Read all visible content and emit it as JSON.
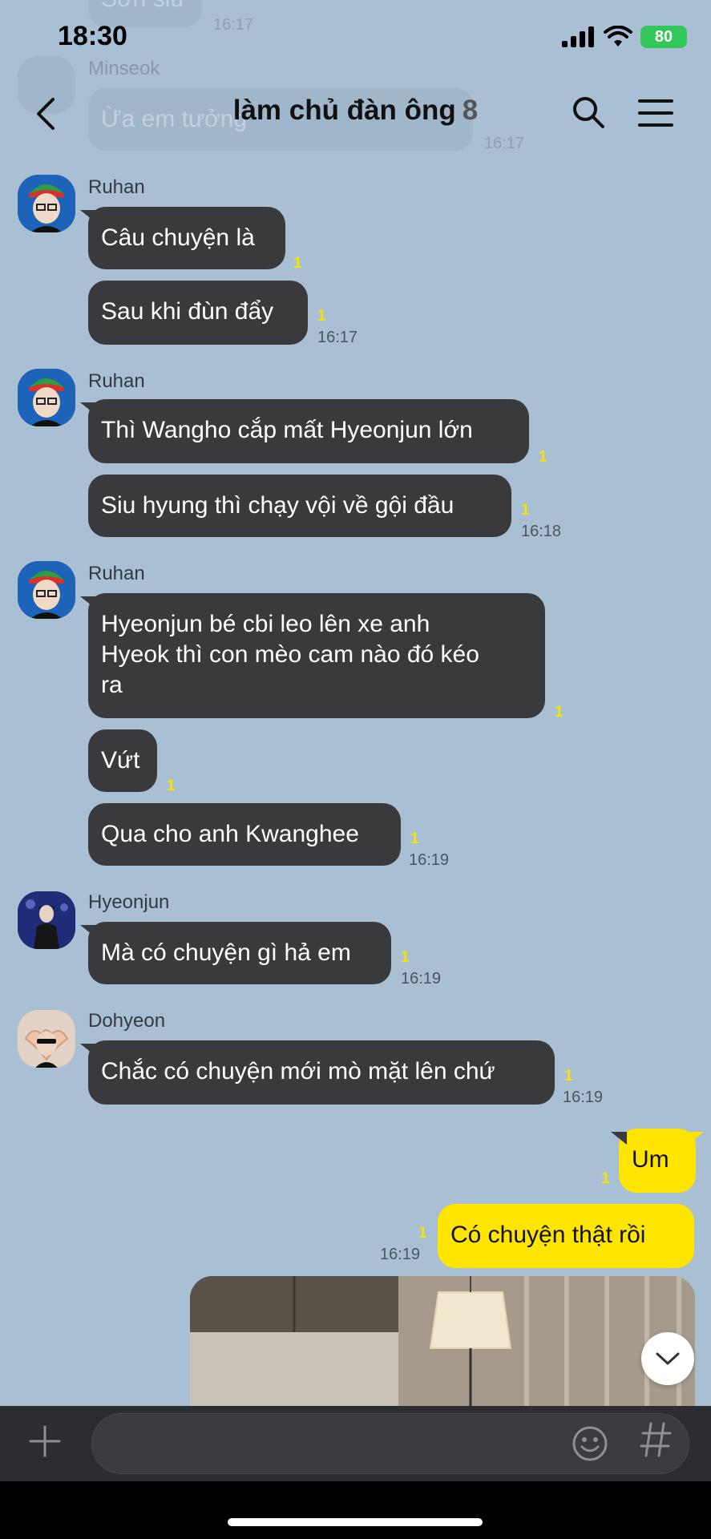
{
  "status_bar": {
    "time": "18:30",
    "battery": "80"
  },
  "header": {
    "title": "làm chủ đàn ông",
    "member_count": "8"
  },
  "ghost": {
    "bubble_top": "Sơn siu",
    "time_top": "16:17",
    "sender": "Minseok",
    "bubble": "Ừa em tưởng",
    "time": "16:17"
  },
  "messages": [
    {
      "sender": "Ruhan",
      "bubbles": [
        {
          "text": "Câu chuyện là",
          "unread": "1"
        },
        {
          "text": "Sau khi đùn đẩy",
          "unread": "1",
          "time": "16:17"
        }
      ]
    },
    {
      "sender": "Ruhan",
      "bubbles": [
        {
          "text": "Thì Wangho cắp mất Hyeonjun lớn",
          "unread": "1"
        },
        {
          "text": "Siu hyung thì chạy vội về gội đầu",
          "unread": "1",
          "time": "16:18"
        }
      ]
    },
    {
      "sender": "Ruhan",
      "bubbles": [
        {
          "lines": [
            "Hyeonjun bé cbi leo lên xe anh",
            "Hyeok thì con mèo cam nào đó kéo",
            "ra"
          ],
          "unread": "1"
        },
        {
          "text": "Vứt",
          "unread": "1"
        },
        {
          "text": "Qua cho anh Kwanghee",
          "unread": "1",
          "time": "16:19"
        }
      ]
    },
    {
      "sender": "Hyeonjun",
      "bubbles": [
        {
          "text": "Mà có chuyện gì hả em",
          "unread": "1",
          "time": "16:19"
        }
      ]
    },
    {
      "sender": "Dohyeon",
      "bubbles": [
        {
          "text": "Chắc có chuyện mới mò mặt lên chứ",
          "unread": "1",
          "time": "16:19"
        }
      ]
    }
  ],
  "my_messages": [
    {
      "text": "Um",
      "unread": "1"
    },
    {
      "text": "Có chuyện thật rồi",
      "unread": "1",
      "time": "16:19"
    }
  ],
  "input": {
    "placeholder": ""
  },
  "icons": {
    "back": "back-arrow-icon",
    "search": "search-icon",
    "menu": "hamburger-menu-icon",
    "plus": "plus-icon",
    "emoji": "emoji-icon",
    "hash": "hashtag-icon",
    "scroll": "chevron-down-icon"
  },
  "colors": {
    "background": "#a9bfd3",
    "bubble_other": "#3a3a3c",
    "bubble_mine": "#fee500",
    "unread": "#f5e400"
  }
}
